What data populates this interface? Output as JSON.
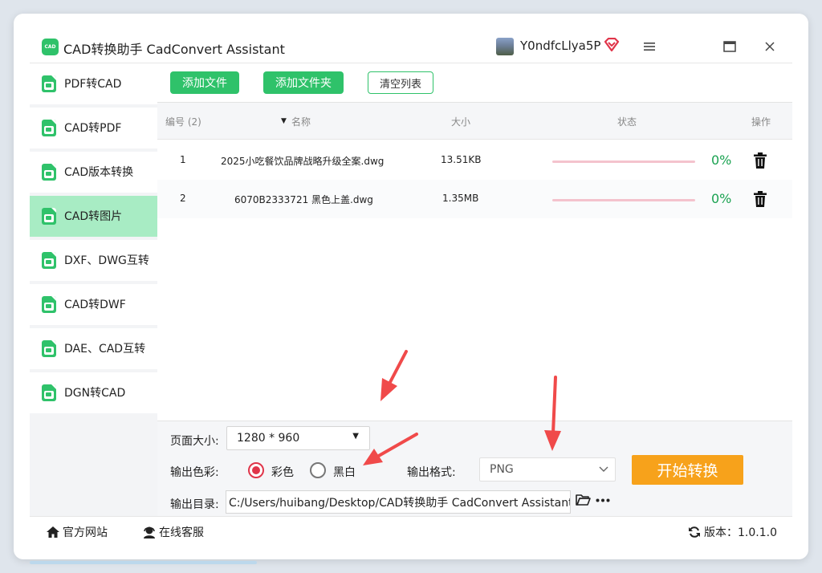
{
  "app": {
    "logo_text": "CAD",
    "title": "CAD转换助手 CadConvert Assistant",
    "username": "Y0ndfcLlya5P",
    "icons": {
      "vip": "vip-diamond-icon",
      "menu": "menu-icon",
      "maximize": "maximize-icon",
      "close": "close-icon"
    }
  },
  "sidebar": {
    "items": [
      {
        "label": "PDF转CAD",
        "active": false
      },
      {
        "label": "CAD转PDF",
        "active": false
      },
      {
        "label": "CAD版本转换",
        "active": false
      },
      {
        "label": "CAD转图片",
        "active": true
      },
      {
        "label": "DXF、DWG互转",
        "active": false
      },
      {
        "label": "CAD转DWF",
        "active": false
      },
      {
        "label": "DAE、CAD互转",
        "active": false
      },
      {
        "label": "DGN转CAD",
        "active": false
      }
    ]
  },
  "toolbar": {
    "add_file": "添加文件",
    "add_folder": "添加文件夹",
    "clear_list": "清空列表"
  },
  "table": {
    "headers": {
      "index": "编号 (2)",
      "name": "名称",
      "size": "大小",
      "status": "状态",
      "action": "操作"
    },
    "rows": [
      {
        "index": "1",
        "name": "2025小吃餐饮品牌战略升级全案.dwg",
        "size": "13.51KB",
        "progress": 0,
        "percent": "0%"
      },
      {
        "index": "2",
        "name": "6070B2333721 黑色上盖.dwg",
        "size": "1.35MB",
        "progress": 0,
        "percent": "0%"
      }
    ]
  },
  "settings": {
    "page_size_label": "页面大小:",
    "page_size_value": "1280 * 960",
    "color_label": "输出色彩:",
    "color_option": "彩色",
    "bw_option": "黑白",
    "selected_color": "彩色",
    "format_label": "输出格式:",
    "format_value": "PNG",
    "start_button": "开始转换",
    "output_dir_label": "输出目录:",
    "output_dir_value": "C:/Users/huibang/Desktop/CAD转换助手 CadConvert Assistant"
  },
  "footer": {
    "website": "官方网站",
    "support": "在线客服",
    "version": "版本：1.0.1.0"
  },
  "colors": {
    "accent": "#2fc26a",
    "active_sidebar": "#a8ecc4",
    "start_button": "#f7a21b",
    "radio_selected": "#e0354a",
    "percent_text": "#1aa251",
    "annotation_arrow": "#f04a4a"
  }
}
